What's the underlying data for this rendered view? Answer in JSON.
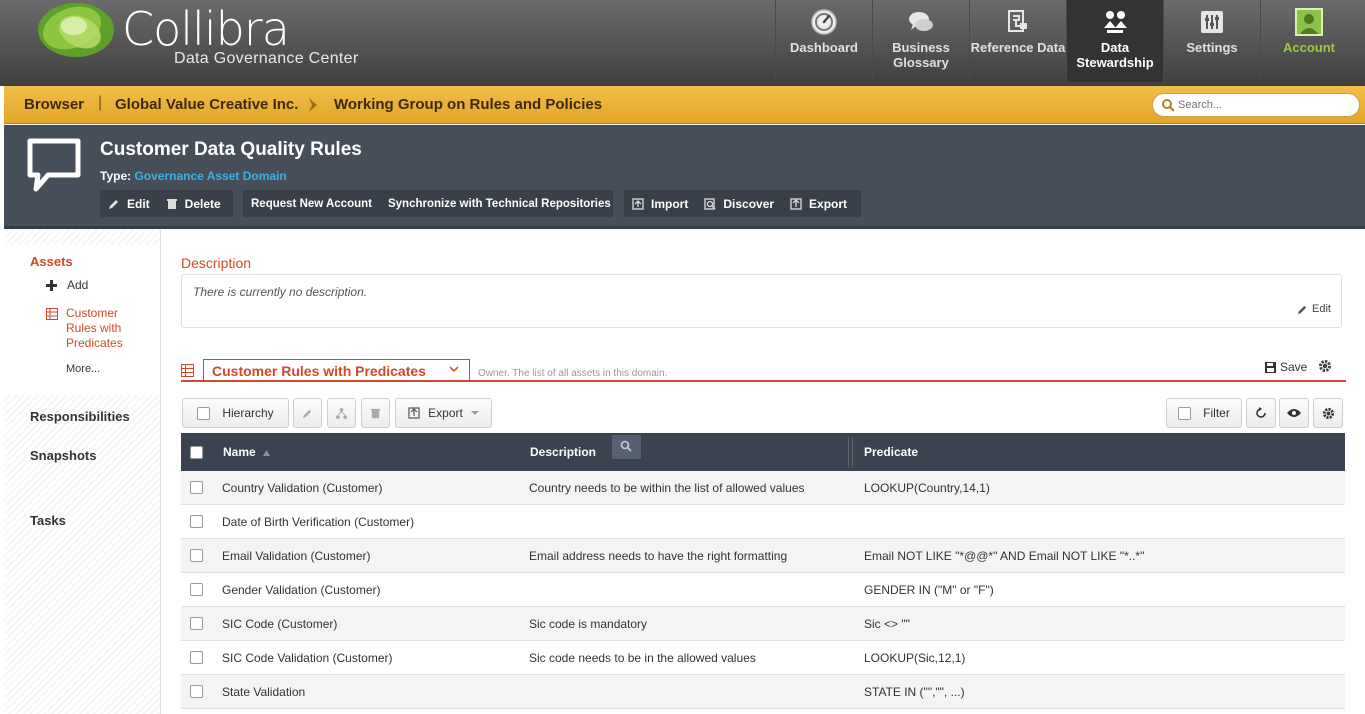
{
  "app": {
    "logo_text": "Collibra",
    "logo_subtitle": "Data Governance Center"
  },
  "nav": [
    {
      "label": "Dashboard",
      "icon": "dashboard-icon"
    },
    {
      "label": "Business Glossary",
      "icon": "chat-bubbles-icon"
    },
    {
      "label": "Reference Data",
      "icon": "reference-icon"
    },
    {
      "label": "Data Stewardship",
      "icon": "stewardship-icon"
    },
    {
      "label": "Settings",
      "icon": "sliders-icon"
    },
    {
      "label": "Account",
      "icon": "user-avatar-icon"
    }
  ],
  "breadcrumb": {
    "root": "Browser",
    "items": [
      "Global Value Creative Inc.",
      "Working Group on Rules and Policies"
    ]
  },
  "search": {
    "placeholder": "Search..."
  },
  "asset": {
    "title": "Customer Data Quality Rules",
    "type_label": "Type:",
    "type_value": "Governance Asset Domain",
    "actions": {
      "edit": "Edit",
      "delete": "Delete",
      "request_account": "Request New Account",
      "sync": "Synchronize with Technical Repositories",
      "import": "Import",
      "discover": "Discover",
      "export": "Export"
    }
  },
  "sidebar": {
    "assets_title": "Assets",
    "add_label": "Add",
    "active_item": "Customer Rules with Predicates",
    "more_label": "More...",
    "sections": [
      "Responsibilities",
      "Snapshots",
      "Tasks"
    ]
  },
  "description": {
    "title": "Description",
    "text": "There is currently no description.",
    "edit_label": "Edit"
  },
  "view": {
    "selected": "Customer Rules with Predicates",
    "note": "Owner. The list of all assets in this domain.",
    "save_label": "Save"
  },
  "toolbar": {
    "hierarchy": "Hierarchy",
    "export": "Export",
    "filter": "Filter"
  },
  "table": {
    "columns": [
      "Name",
      "Description",
      "Predicate"
    ],
    "rows": [
      {
        "name": "Country Validation (Customer)",
        "description": "Country needs to be within the list of allowed values",
        "predicate": "LOOKUP(Country,14,1)"
      },
      {
        "name": "Date of Birth Verification (Customer)",
        "description": "",
        "predicate": ""
      },
      {
        "name": "Email Validation (Customer)",
        "description": "Email address needs to have the right formatting",
        "predicate": "Email NOT LIKE \"*@@*\" AND Email NOT LIKE \"*..*\""
      },
      {
        "name": "Gender Validation (Customer)",
        "description": "",
        "predicate": "GENDER IN (\"M\" or \"F\")"
      },
      {
        "name": "SIC Code (Customer)",
        "description": "Sic code is mandatory",
        "predicate": "Sic <> \"\""
      },
      {
        "name": "SIC Code Validation (Customer)",
        "description": "Sic code needs to be in the allowed values",
        "predicate": "LOOKUP(Sic,12,1)"
      },
      {
        "name": "State Validation",
        "description": "",
        "predicate": "STATE IN (\"\",\"\", ...)"
      }
    ]
  }
}
